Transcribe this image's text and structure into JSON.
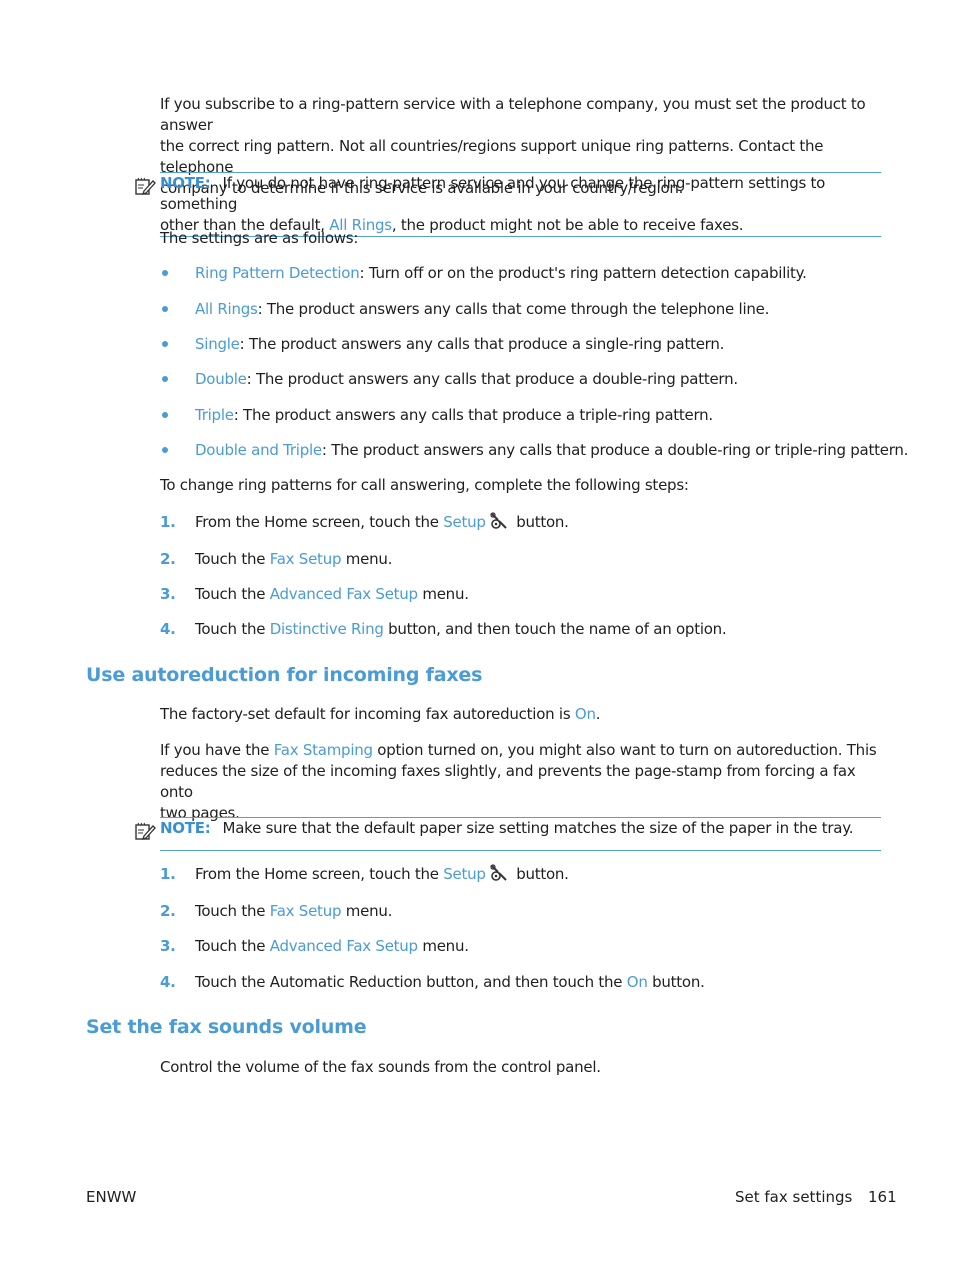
{
  "intro": {
    "line1": "If you subscribe to a ring-pattern service with a telephone company, you must set the product to answer",
    "line2": "the correct ring pattern. Not all countries/regions support unique ring patterns. Contact the telephone",
    "line3": "company to determine if this service is available in your country/region."
  },
  "note1": {
    "label": "NOTE:",
    "text_a": "If you do not have ring-pattern service and you change the ring-pattern settings to something",
    "text_b": "other than the default, ",
    "link": "All Rings",
    "text_c": ", the product might not be able to receive faxes."
  },
  "settings_intro": "The settings are as follows:",
  "settings": [
    {
      "term": "Ring Pattern Detection",
      "desc": ": Turn off or on the product's ring pattern detection capability."
    },
    {
      "term": "All Rings",
      "desc": ": The product answers any calls that come through the telephone line."
    },
    {
      "term": "Single",
      "desc": ": The product answers any calls that produce a single-ring pattern."
    },
    {
      "term": "Double",
      "desc": ": The product answers any calls that produce a double-ring pattern."
    },
    {
      "term": "Triple",
      "desc": ": The product answers any calls that produce a triple-ring pattern."
    },
    {
      "term": "Double and Triple",
      "desc": ": The product answers any calls that produce a double-ring or triple-ring pattern."
    }
  ],
  "steps_intro": "To change ring patterns for call answering, complete the following steps:",
  "steps1": [
    {
      "num": "1.",
      "pre": "From the Home screen, touch the ",
      "link": "Setup",
      "post": " button.",
      "icon": "setup-wrench-icon"
    },
    {
      "num": "2.",
      "pre": "Touch the ",
      "link": "Fax Setup",
      "post": " menu."
    },
    {
      "num": "3.",
      "pre": "Touch the ",
      "link": "Advanced Fax Setup",
      "post": " menu."
    },
    {
      "num": "4.",
      "pre": "Touch the ",
      "link": "Distinctive Ring",
      "post": " button, and then touch the name of an option."
    }
  ],
  "section2": {
    "heading": "Use autoreduction for incoming faxes",
    "p1_pre": "The factory-set default for incoming fax autoreduction is ",
    "p1_link": "On",
    "p1_post": ".",
    "p2_pre": "If you have the ",
    "p2_link": "Fax Stamping",
    "p2_post": " option turned on, you might also want to turn on autoreduction. This",
    "p2_line2": "reduces the size of the incoming faxes slightly, and prevents the page-stamp from forcing a fax onto",
    "p2_line3": "two pages.",
    "note_label": "NOTE:",
    "note_text": "Make sure that the default paper size setting matches the size of the paper in the tray."
  },
  "steps2": [
    {
      "num": "1.",
      "pre": "From the Home screen, touch the ",
      "link": "Setup",
      "post": " button.",
      "icon": "setup-wrench-icon"
    },
    {
      "num": "2.",
      "pre": "Touch the ",
      "link": "Fax Setup",
      "post": " menu."
    },
    {
      "num": "3.",
      "pre": "Touch the ",
      "link": "Advanced Fax Setup",
      "post": " menu."
    },
    {
      "num": "4.",
      "pre": "Touch the Automatic Reduction button, and then touch the ",
      "link": "On",
      "post": " button."
    }
  ],
  "section3": {
    "heading": "Set the fax sounds volume",
    "p1": "Control the volume of the fax sounds from the control panel."
  },
  "footer": {
    "left": "ENWW",
    "section": "Set fax settings",
    "page": "161"
  }
}
